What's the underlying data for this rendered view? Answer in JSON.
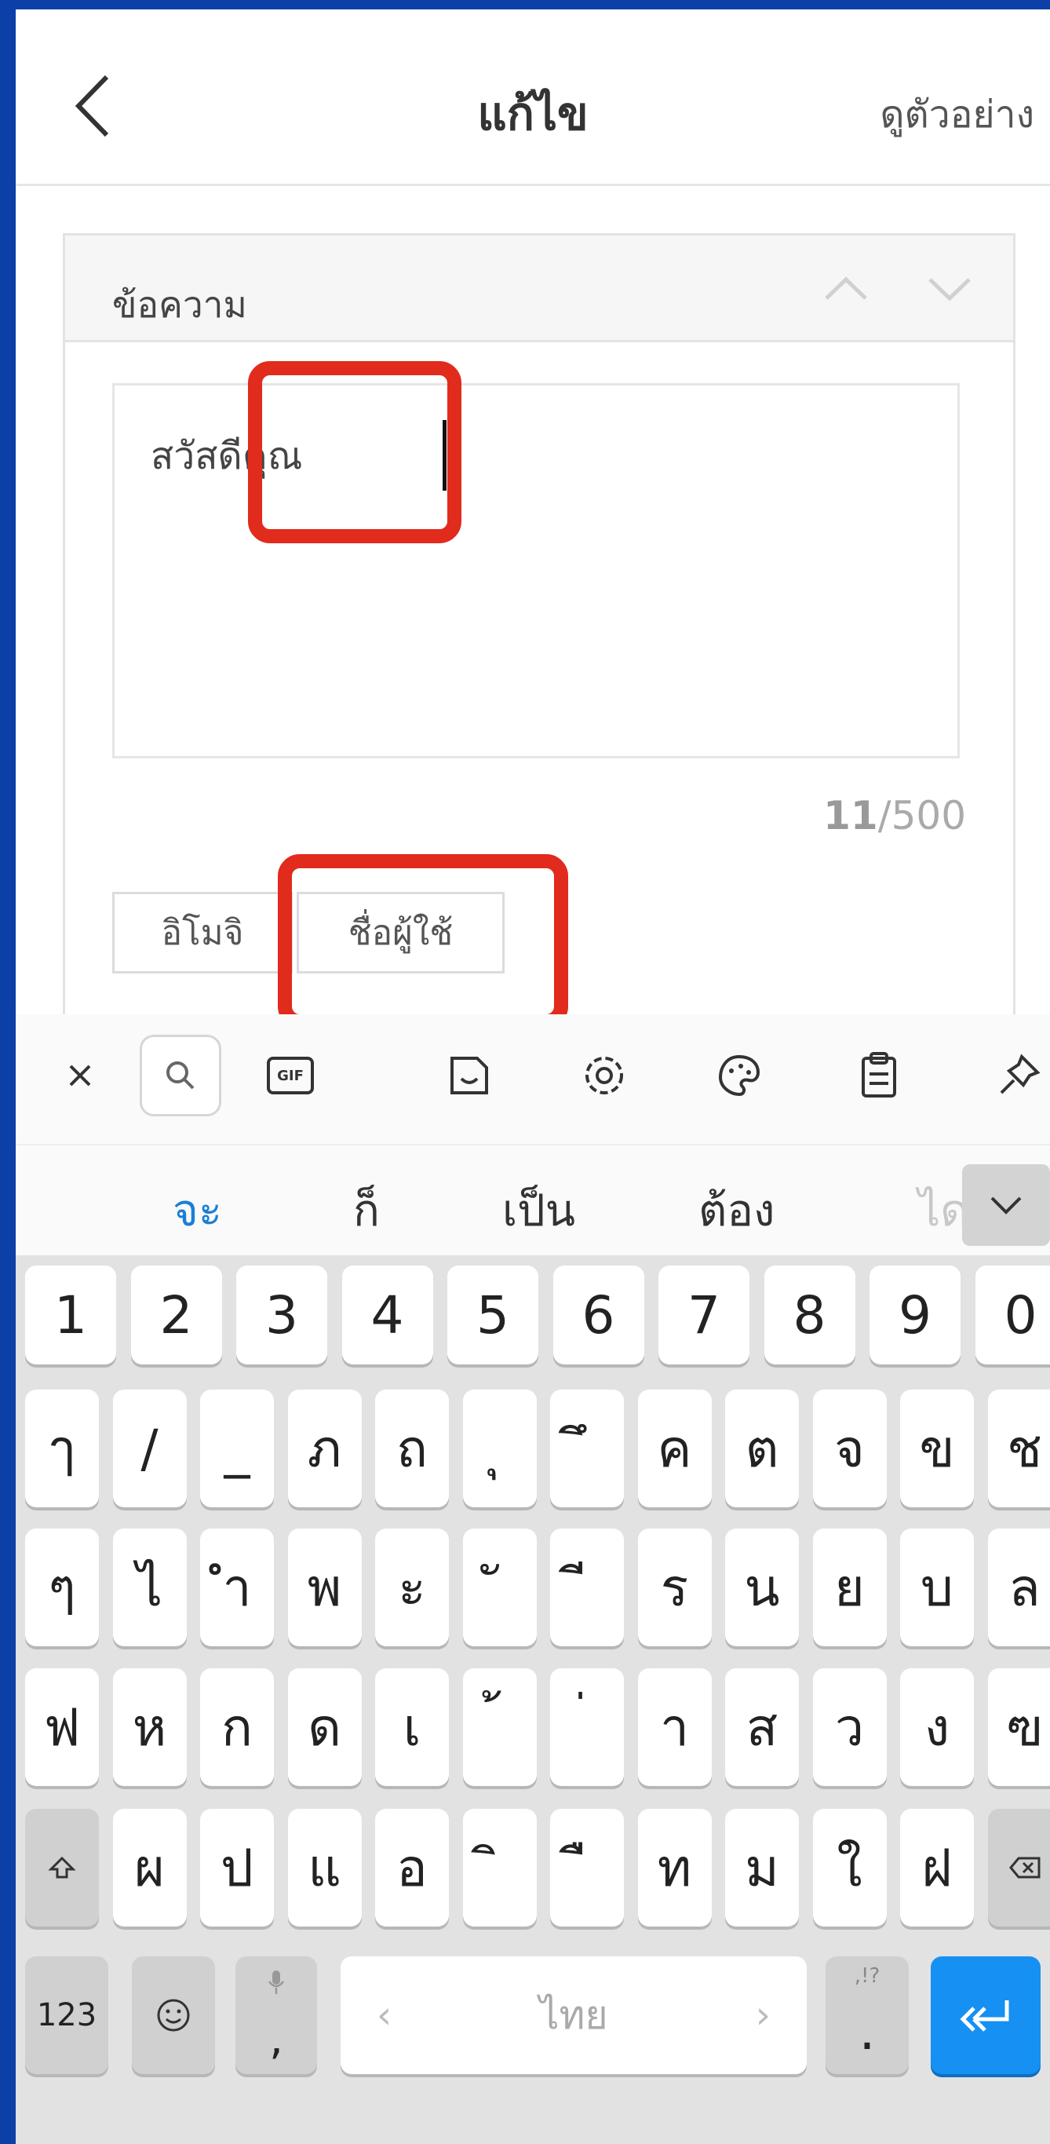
{
  "header": {
    "title": "แก้ไข",
    "preview_label": "ดูตัวอย่าง"
  },
  "card": {
    "title": "ข้อความ",
    "message_text": "สวัสดีคุณ",
    "counter_current": "11",
    "counter_max": "/500",
    "chip_emoji": "อิโมจิ",
    "chip_username": "ชื่อผู้ใช้"
  },
  "keyboard": {
    "toolbar": [
      "close-icon",
      "search-icon",
      "gif-icon",
      "sticker-icon",
      "settings-icon",
      "palette-icon",
      "clipboard-icon",
      "pin-icon"
    ],
    "gif_label": "GIF",
    "suggestions": [
      "จะ",
      "ก็",
      "เป็น",
      "ต้อง",
      "ได"
    ],
    "row_numbers": [
      "1",
      "2",
      "3",
      "4",
      "5",
      "6",
      "7",
      "8",
      "9",
      "0"
    ],
    "row_1": [
      "ๅ",
      "/",
      "_",
      "ภ",
      "ถ",
      "ุ",
      "ึ",
      "ค",
      "ต",
      "จ",
      "ข",
      "ช"
    ],
    "row_2": [
      "ๆ",
      "ไ",
      "ำ",
      "พ",
      "ะ",
      "ั",
      "ี",
      "ร",
      "น",
      "ย",
      "บ",
      "ล"
    ],
    "row_3": [
      "ฟ",
      "ห",
      "ก",
      "ด",
      "เ",
      "้",
      "่",
      "า",
      "ส",
      "ว",
      "ง",
      "ฃ"
    ],
    "row_4": [
      "ผ",
      "ป",
      "แ",
      "อ",
      "ิ",
      "ื",
      "ท",
      "ม",
      "ใ",
      "ฝ"
    ],
    "numbers_label": "123",
    "mic_comma": ",",
    "space_label": "ไทย",
    "space_left": "‹",
    "space_right": "›",
    "punct_label": ".",
    "punct_hint": ",!?"
  },
  "colors": {
    "frame": "#0c3fa8",
    "accent": "#1690f3",
    "highlight": "#e12b1c"
  }
}
